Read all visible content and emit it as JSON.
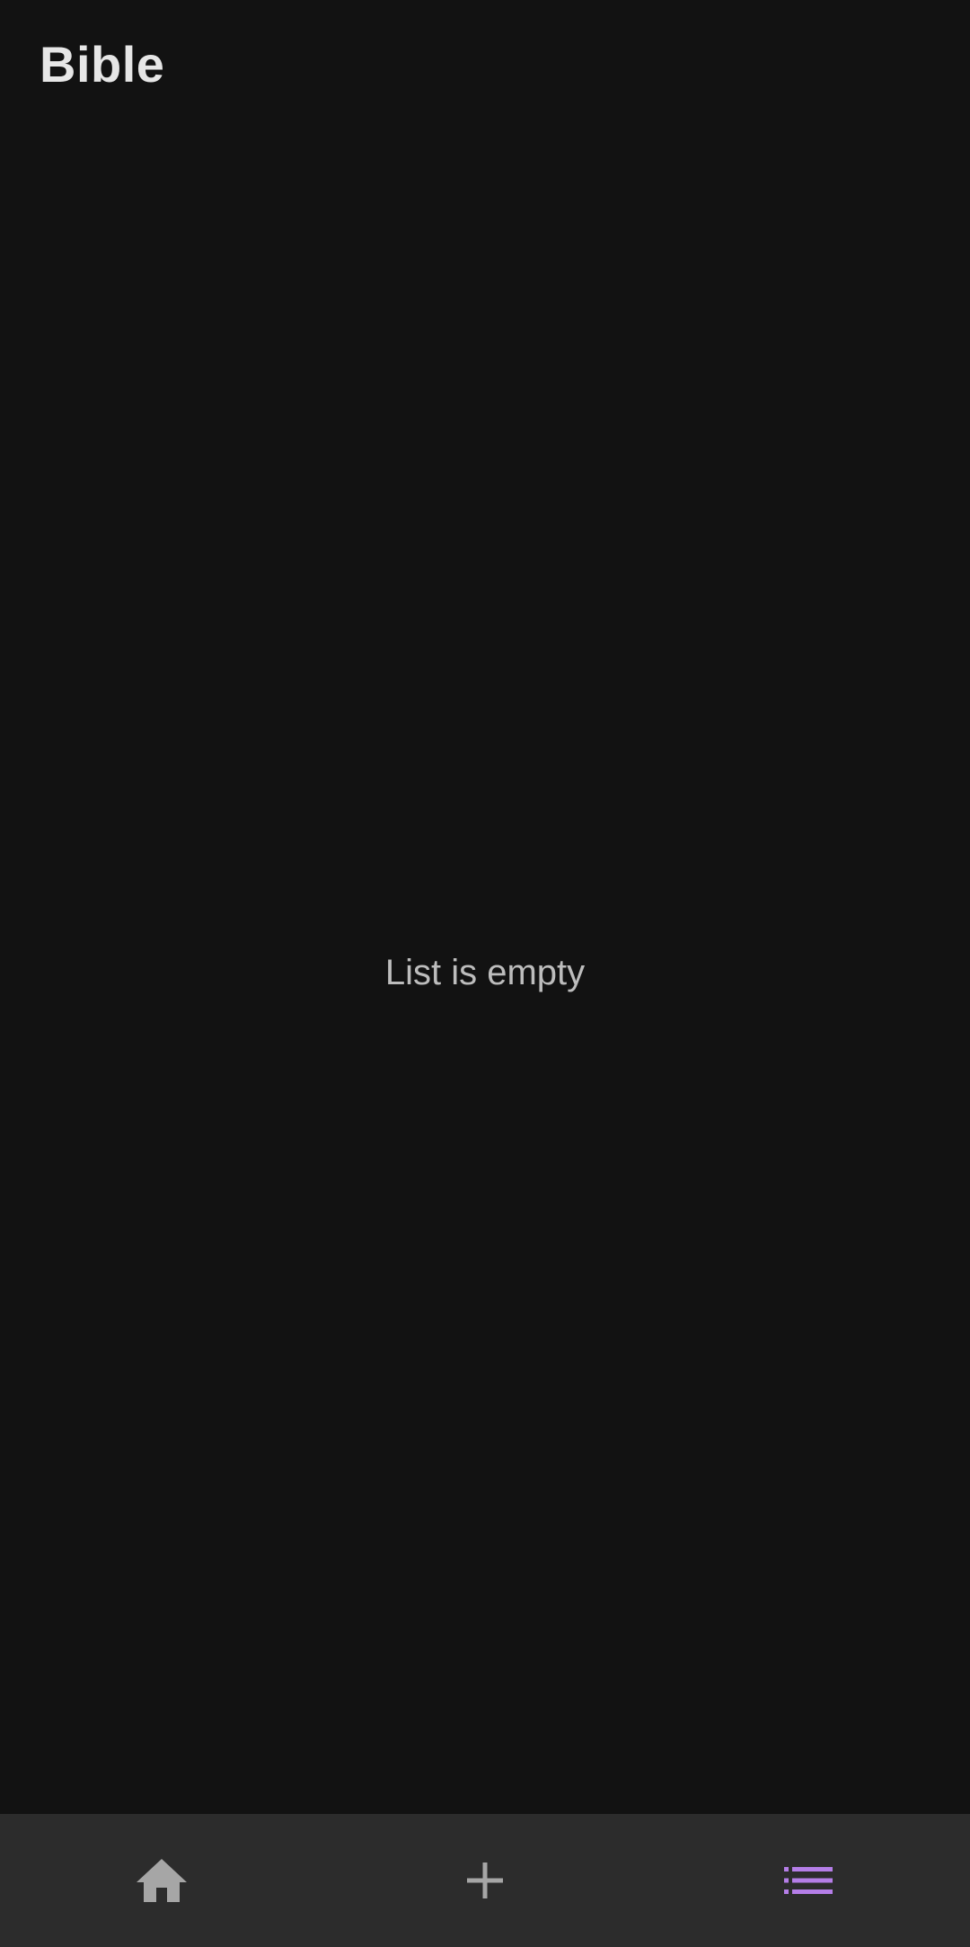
{
  "app_bar": {
    "title": "Bible"
  },
  "main": {
    "empty_message": "List is empty"
  },
  "bottom_nav": {
    "items": [
      {
        "icon": "home-icon",
        "active": false
      },
      {
        "icon": "add-icon",
        "active": false
      },
      {
        "icon": "list-icon",
        "active": true
      }
    ],
    "colors": {
      "inactive": "#a6a6a6",
      "active": "#b57ee8",
      "background": "#2c2c2c"
    }
  },
  "colors": {
    "background": "#121212",
    "title": "#e6e6e6",
    "empty_text": "#bdbdbd"
  }
}
